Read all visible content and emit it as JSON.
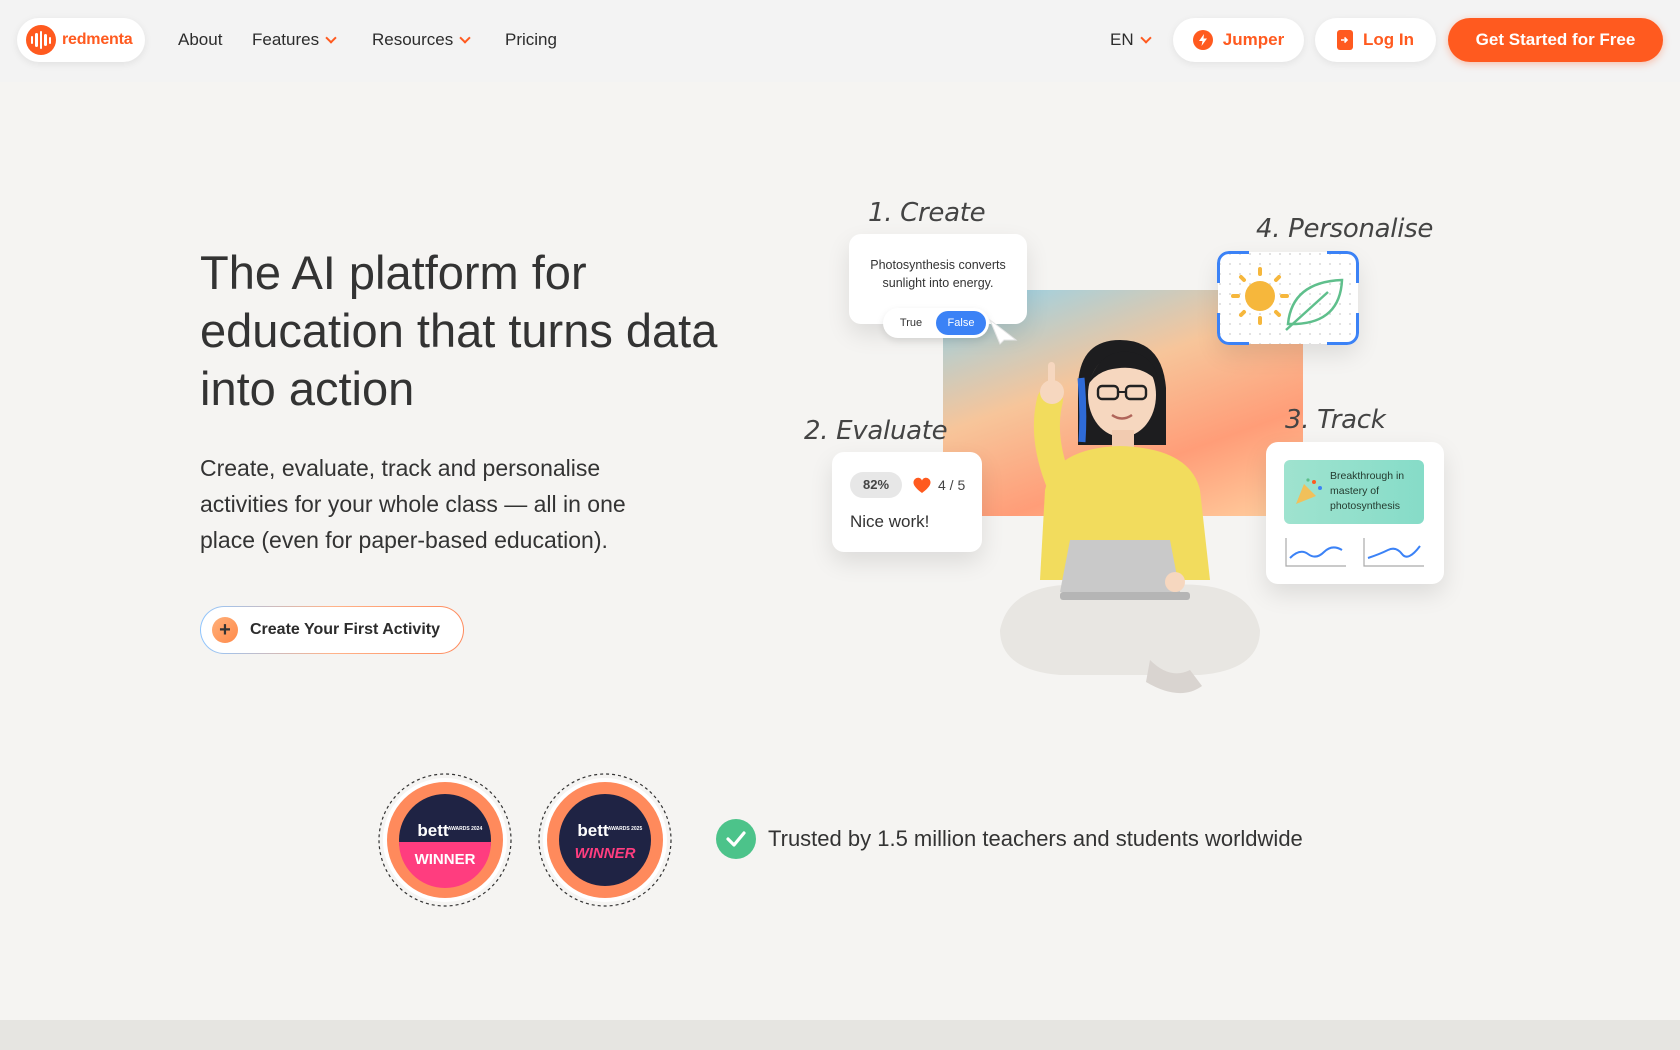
{
  "brand": {
    "name": "redmenta",
    "color": "#ff5a1f"
  },
  "nav": {
    "links": [
      {
        "label": "About"
      },
      {
        "label": "Features"
      },
      {
        "label": "Resources"
      },
      {
        "label": "Pricing"
      }
    ],
    "language": "EN",
    "jumper_label": "Jumper",
    "login_label": "Log In",
    "signup_label": "Get Started for Free"
  },
  "hero": {
    "title": "The AI platform for education that turns data into action",
    "subtitle": "Create, evaluate, track and personalise activities for your whole class — all in one place (even for paper-based education).",
    "cta_label": "Create Your First Activity"
  },
  "illustration": {
    "step1": "1. Create",
    "step2": "2. Evaluate",
    "step3": "3. Track",
    "step4": "4. Personalise",
    "create_card_text": "Photosynthesis converts sunlight into energy.",
    "true_label": "True",
    "false_label": "False",
    "eval_percent": "82%",
    "eval_score": "4 / 5",
    "eval_feedback": "Nice work!",
    "track_text": "Breakthrough in mastery of photosynthesis"
  },
  "awards": {
    "badge1": {
      "brand": "bett",
      "label": "WINNER",
      "subtitle": "AWARDS 2024"
    },
    "badge2": {
      "brand": "bett",
      "label": "WINNER",
      "subtitle": "AWARDS 2025"
    },
    "trusted_text": "Trusted by 1.5 million teachers and students worldwide"
  }
}
